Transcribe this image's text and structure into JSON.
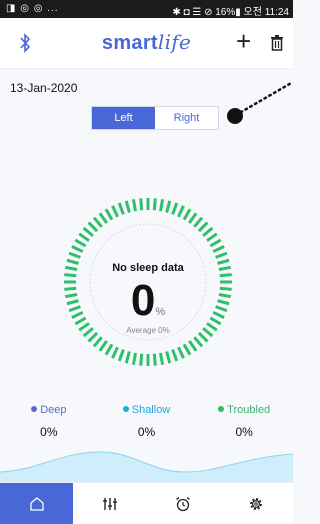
{
  "statusbar": {
    "left_text": "◨ ◎ ◎ ...",
    "right_text": "✱ ◘ ☰ ⊘ 16%▮ 오전 11:24"
  },
  "header": {
    "brand_primary": "smart",
    "brand_secondary": "life",
    "add_label": "+",
    "icons": [
      "bluetooth-icon",
      "trash-icon"
    ]
  },
  "main": {
    "date": "13-Jan-2020",
    "toggle": [
      {
        "label": "Left",
        "active": true
      },
      {
        "label": "Right",
        "active": false
      }
    ],
    "ring": {
      "status": "No sleep data",
      "value": "0",
      "unit": "%",
      "average": "Average 0%"
    },
    "legend": [
      {
        "label": "Deep",
        "value": "0%",
        "color": "#5b6ac9"
      },
      {
        "label": "Shallow",
        "value": "0%",
        "color": "#1fa6e3"
      },
      {
        "label": "Troubled",
        "value": "0%",
        "color": "#39b76a"
      }
    ]
  },
  "tabbar": {
    "items": [
      {
        "name": "home-icon",
        "active": true
      },
      {
        "name": "sliders-icon",
        "active": false
      },
      {
        "name": "alarm-icon",
        "active": false
      },
      {
        "name": "settings-icon",
        "active": false
      }
    ]
  },
  "colors": {
    "accent": "#4a67d8",
    "ring_green": "#2ebf6a",
    "wave": "#cdeefa"
  }
}
